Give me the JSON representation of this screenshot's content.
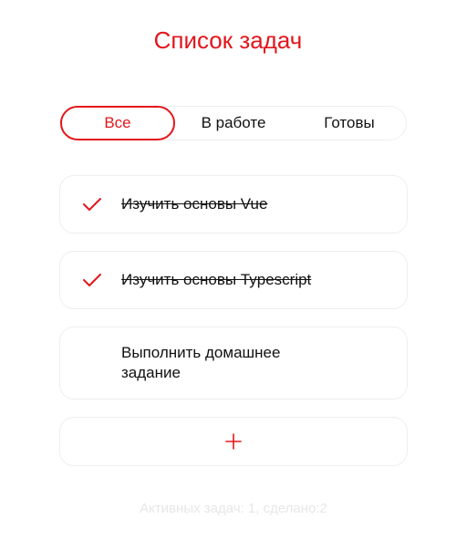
{
  "header": {
    "title": "Список задач"
  },
  "tabs": [
    {
      "label": "Все",
      "active": true
    },
    {
      "label": "В работе",
      "active": false
    },
    {
      "label": "Готовы",
      "active": false
    }
  ],
  "tasks": [
    {
      "text": "Изучить основы Vue",
      "done": true
    },
    {
      "text": "Изучить основы Typescript",
      "done": true
    },
    {
      "text": "Выполнить домашнее задание",
      "done": false
    }
  ],
  "add_button": {
    "icon": "plus-icon"
  },
  "footer": {
    "status": "Активных задач: 1, сделано:2"
  },
  "colors": {
    "accent": "#e3161b",
    "border": "#eeeeee",
    "muted": "#e7e7e7",
    "text": "#111111"
  }
}
